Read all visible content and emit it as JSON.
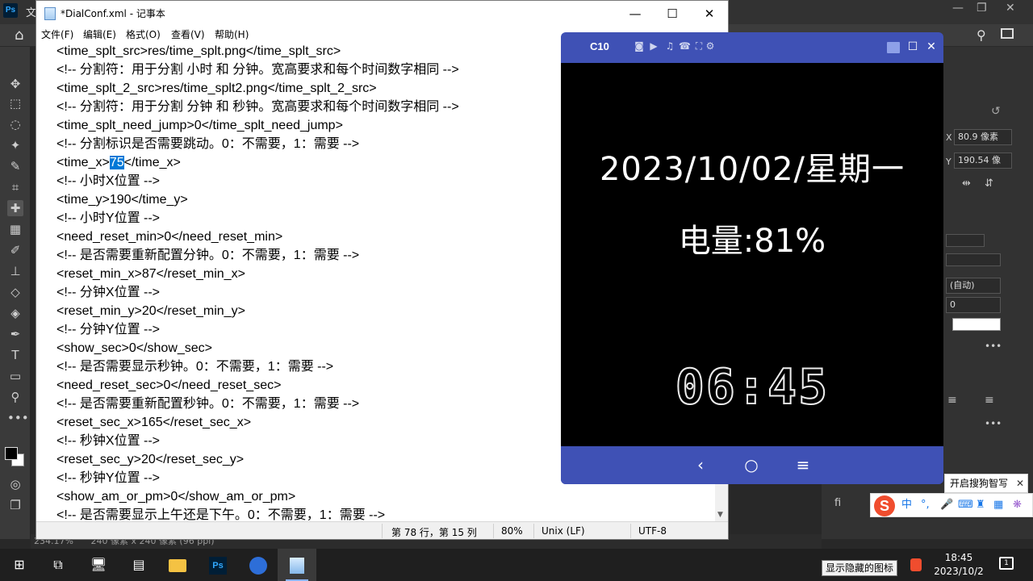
{
  "photoshop": {
    "logo": "Ps",
    "menu_first": "文",
    "status_zoom": "234.17%",
    "status_doc": "240 像素 x 240 像素 (96 ppi)",
    "x_label": "X",
    "x_value": "80.9 像素",
    "y_label": "Y",
    "y_value": "190.54 像",
    "dropdown_auto": "(自动)",
    "dropdown_zero": "0",
    "fi_label": "fi"
  },
  "notepad": {
    "title": "*DialConf.xml - 记事本",
    "menu": [
      "文件(F)",
      "编辑(E)",
      "格式(O)",
      "查看(V)",
      "帮助(H)"
    ],
    "lines": [
      "<time_splt_src>res/time_splt.png</time_splt_src>",
      "<!-- 分割符：用于分割 小时 和 分钟。宽高要求和每个时间数字相同 -->",
      "<time_splt_2_src>res/time_splt2.png</time_splt_2_src>",
      "<!-- 分割符：用于分割 分钟 和 秒钟。宽高要求和每个时间数字相同 -->",
      "<time_splt_need_jump>0</time_splt_need_jump>",
      "<!-- 分割标识是否需要跳动。0：不需要，1：需要 -->",
      "<time_x>",
      "<!-- 小时X位置 -->",
      "<time_y>190</time_y>",
      "<!-- 小时Y位置 -->",
      "<need_reset_min>0</need_reset_min>",
      "<!-- 是否需要重新配置分钟。0：不需要，1：需要 -->",
      "<reset_min_x>87</reset_min_x>",
      "<!-- 分钟X位置 -->",
      "<reset_min_y>20</reset_min_y>",
      "<!-- 分钟Y位置 -->",
      "<show_sec>0</show_sec>",
      "<!-- 是否需要显示秒钟。0：不需要，1：需要 -->",
      "<need_reset_sec>0</need_reset_sec>",
      "<!-- 是否需要重新配置秒钟。0：不需要，1：需要 -->",
      "<reset_sec_x>165</reset_sec_x>",
      "<!-- 秒钟X位置 -->",
      "<reset_sec_y>20</reset_sec_y>",
      "<!-- 秒钟Y位置 -->",
      "<show_am_or_pm>0</show_am_or_pm>",
      "<!-- 是否需要显示上午还是下午。0：不需要，1：需要 -->"
    ],
    "selected_text": "75",
    "selected_suffix": "</time_x>",
    "status": {
      "position": "第 78 行，第 15 列",
      "zoom": "80%",
      "line_ending": "Unix (LF)",
      "encoding": "UTF-8"
    }
  },
  "emulator": {
    "title": "C10",
    "date_text": "2023/10/02/星期一",
    "battery_text": "电量:81%",
    "time_text": "06:45",
    "accent_color": "#3f51b5"
  },
  "sogou": {
    "tip": "开启搜狗智写",
    "close": "✕",
    "logo": "S",
    "lang": "中",
    "punct": "°,"
  },
  "taskbar": {
    "time": "18:45",
    "date": "2023/10/2",
    "tooltip": "显示隐藏的图标",
    "notification_count": "1",
    "ps_label": "Ps"
  }
}
